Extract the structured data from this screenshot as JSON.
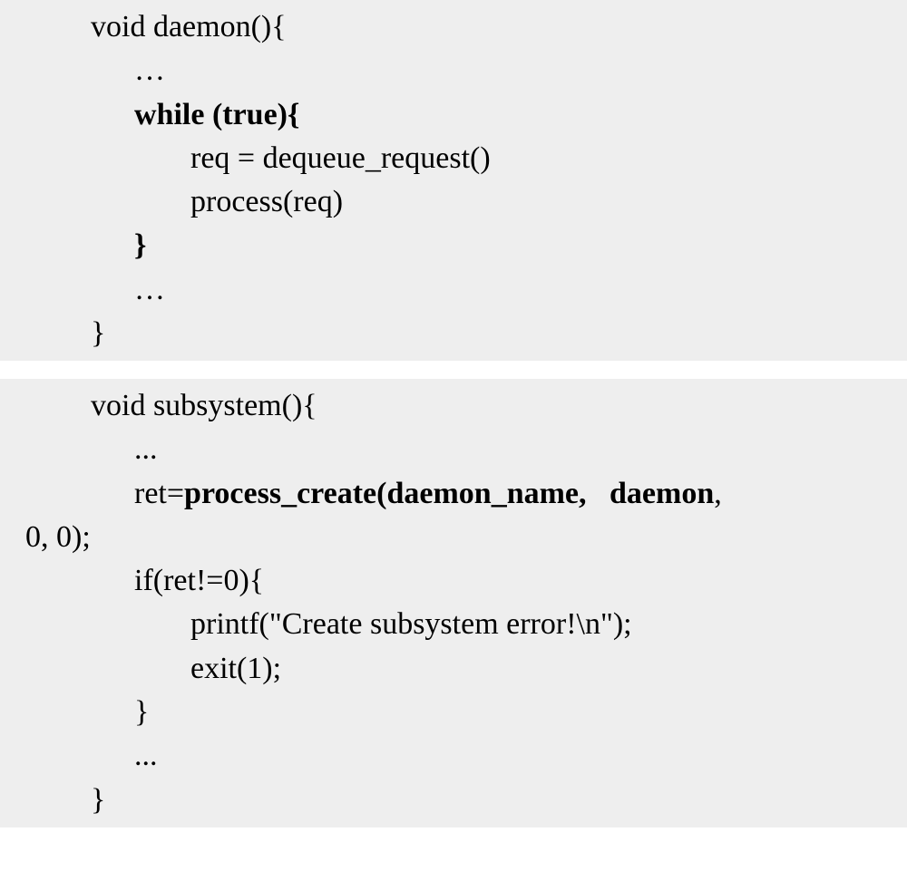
{
  "panel1": {
    "l1": "void daemon(){",
    "l2": "…",
    "l3": "while (true){",
    "l4": "req = dequeue_request()",
    "l5": "process(req)",
    "l6": "}",
    "l7": "…",
    "l8": "}"
  },
  "panel2": {
    "l1": "void subsystem(){",
    "l2": "...",
    "l3a": "ret=",
    "l3b": "process_create(daemon_name,   daemon",
    "l3c": ",",
    "l4": "0, 0);",
    "l5": "if(ret!=0){",
    "l6": "printf(\"Create subsystem error!\\n\");",
    "l7": "exit(1);",
    "l8": "}",
    "l9": "...",
    "l10": "}"
  }
}
